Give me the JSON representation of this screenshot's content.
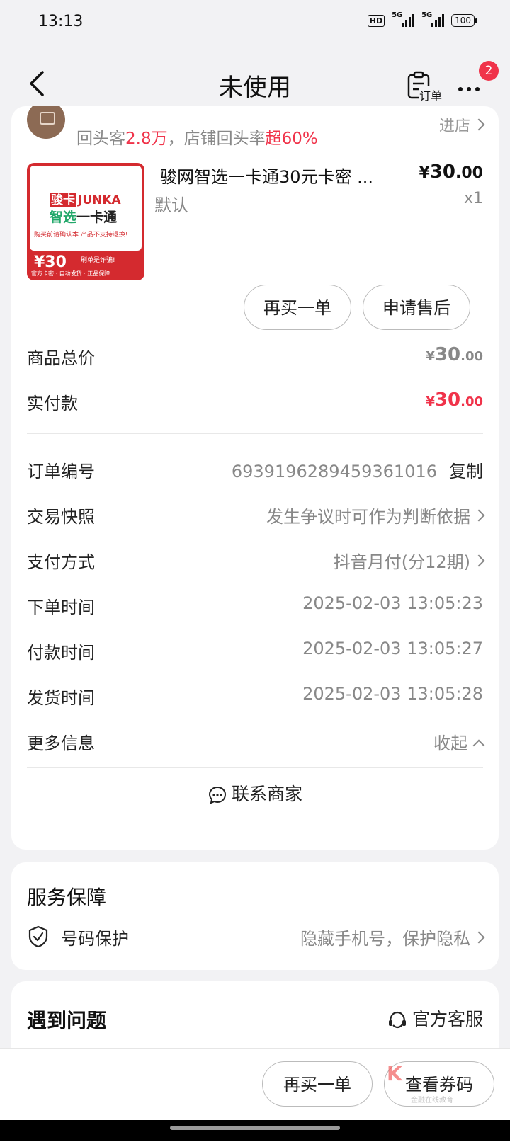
{
  "status_bar": {
    "time": "13:13",
    "hd": "HD",
    "signal1": "5G",
    "signal2": "5G",
    "battery": "100"
  },
  "nav": {
    "title": "未使用",
    "order_label": "订单",
    "badge_count": "2"
  },
  "shop": {
    "stats_prefix": "回头客",
    "stats_count": "2.8万",
    "stats_mid": "，店铺回头率",
    "stats_rate": "超60%",
    "enter_label": "进店"
  },
  "product": {
    "image": {
      "brand_badge": "骏卡",
      "brand_name": "JUNKA",
      "sub_green": "智选",
      "sub_dark": "一卡通",
      "note": "购买前请确认本 产品不支持退换!",
      "price": "¥30",
      "warn": "刷单是诈骗!",
      "footer": "官方卡密 · 自动发货 · 正品保障"
    },
    "name": "骏网智选一卡通30元卡密 ...",
    "price_currency": "¥",
    "price_int": "30",
    "price_dec": ".00",
    "spec": "默认",
    "qty": "x1"
  },
  "actions": {
    "rebuy": "再买一单",
    "aftersale": "申请售后"
  },
  "pricing": {
    "total_label": "商品总价",
    "total_currency": "¥",
    "total_int": "30",
    "total_dec": ".00",
    "paid_label": "实付款",
    "paid_currency": "¥",
    "paid_int": "30",
    "paid_dec": ".00"
  },
  "details": {
    "order_no_label": "订单编号",
    "order_no": "6939196289459361016",
    "copy_label": "复制",
    "snapshot_label": "交易快照",
    "snapshot_value": "发生争议时可作为判断依据",
    "payment_label": "支付方式",
    "payment_value": "抖音月付(分12期)",
    "order_time_label": "下单时间",
    "order_time": "2025-02-03 13:05:23",
    "pay_time_label": "付款时间",
    "pay_time": "2025-02-03 13:05:27",
    "ship_time_label": "发货时间",
    "ship_time": "2025-02-03 13:05:28",
    "more_label": "更多信息",
    "collapse_label": "收起"
  },
  "contact_label": "联系商家",
  "service": {
    "title": "服务保障",
    "item_label": "号码保护",
    "item_value": "隐藏手机号，保护隐私"
  },
  "issue": {
    "title": "遇到问题",
    "cs_label": "官方客服"
  },
  "bottom": {
    "rebuy": "再买一单",
    "view_code": "查看券码",
    "watermark": "金融在线教育"
  },
  "colors": {
    "accent_red": "#f0334a",
    "price_red": "#f0334a"
  }
}
